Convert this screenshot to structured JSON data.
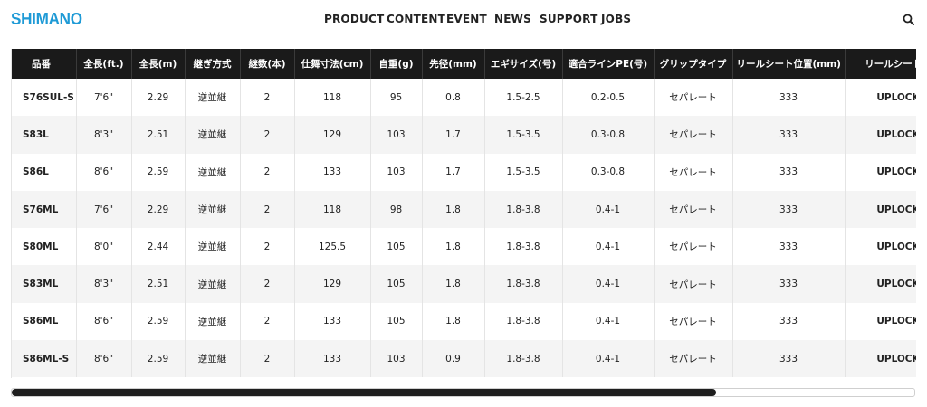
{
  "brand": {
    "logo_text": "SHIMANO",
    "accent": "#1e9ad6"
  },
  "nav": [
    "PRODUCT",
    "CONTENT",
    "EVENT",
    "NEWS",
    "SUPPORT",
    "JOBS"
  ],
  "icons": {
    "search": "search-icon"
  },
  "table": {
    "headers": [
      "品番",
      "全長(ft.)",
      "全長(m)",
      "継ぎ方式",
      "継数(本)",
      "仕舞寸法(cm)",
      "自重(g)",
      "先径(mm)",
      "エギサイズ(号)",
      "適合ラインPE(号)",
      "グリップタイプ",
      "リールシート位置(mm)",
      "リールシートタ"
    ],
    "rows": [
      [
        "S76SUL-S",
        "7'6\"",
        "2.29",
        "逆並継",
        "2",
        "118",
        "95",
        "0.8",
        "1.5-2.5",
        "0.2-0.5",
        "セパレート",
        "333",
        "UPLOCK"
      ],
      [
        "S83L",
        "8'3\"",
        "2.51",
        "逆並継",
        "2",
        "129",
        "103",
        "1.7",
        "1.5-3.5",
        "0.3-0.8",
        "セパレート",
        "333",
        "UPLOCK"
      ],
      [
        "S86L",
        "8'6\"",
        "2.59",
        "逆並継",
        "2",
        "133",
        "103",
        "1.7",
        "1.5-3.5",
        "0.3-0.8",
        "セパレート",
        "333",
        "UPLOCK"
      ],
      [
        "S76ML",
        "7'6\"",
        "2.29",
        "逆並継",
        "2",
        "118",
        "98",
        "1.8",
        "1.8-3.8",
        "0.4-1",
        "セパレート",
        "333",
        "UPLOCK"
      ],
      [
        "S80ML",
        "8'0\"",
        "2.44",
        "逆並継",
        "2",
        "125.5",
        "105",
        "1.8",
        "1.8-3.8",
        "0.4-1",
        "セパレート",
        "333",
        "UPLOCK"
      ],
      [
        "S83ML",
        "8'3\"",
        "2.51",
        "逆並継",
        "2",
        "129",
        "105",
        "1.8",
        "1.8-3.8",
        "0.4-1",
        "セパレート",
        "333",
        "UPLOCK"
      ],
      [
        "S86ML",
        "8'6\"",
        "2.59",
        "逆並継",
        "2",
        "133",
        "105",
        "1.8",
        "1.8-3.8",
        "0.4-1",
        "セパレート",
        "333",
        "UPLOCK"
      ],
      [
        "S86ML-S",
        "8'6\"",
        "2.59",
        "逆並継",
        "2",
        "133",
        "103",
        "0.9",
        "1.8-3.8",
        "0.4-1",
        "セパレート",
        "333",
        "UPLOCK"
      ]
    ]
  },
  "scroll": {
    "position_fraction": 0.0,
    "visible_fraction": 0.78
  }
}
